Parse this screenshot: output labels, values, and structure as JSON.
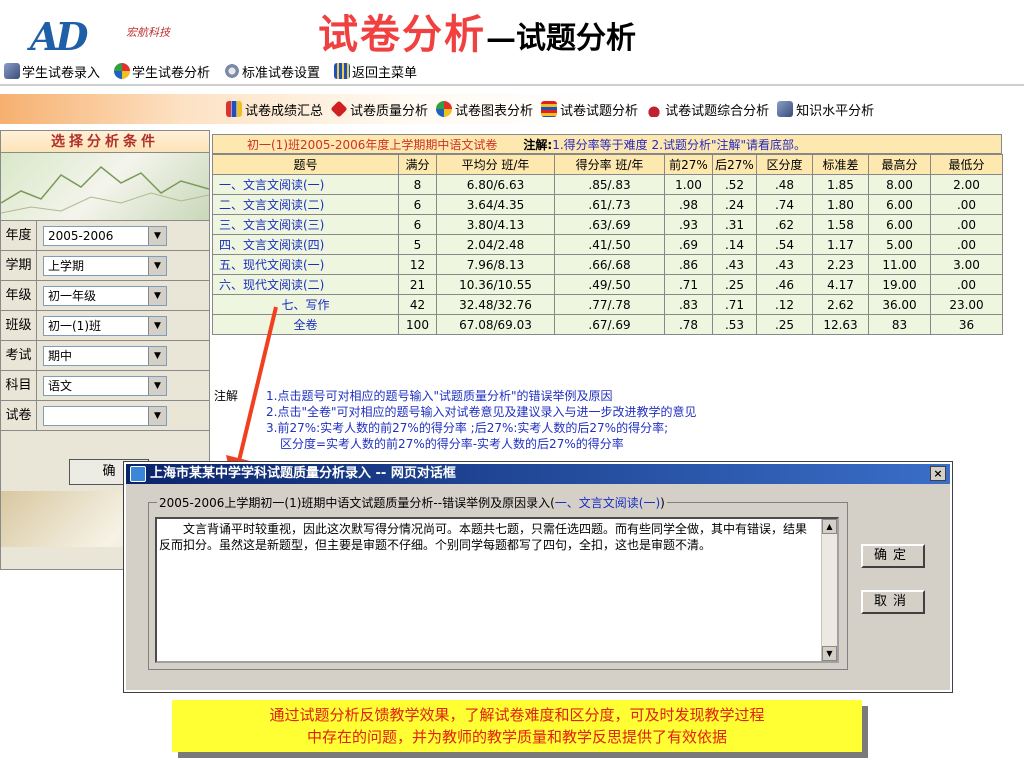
{
  "header": {
    "logo_brand": "宏航科技",
    "title_main": "试卷分析",
    "title_sub": "—试题分析",
    "menu": [
      {
        "label": "学生试卷录入",
        "icon": "pencil-icon"
      },
      {
        "label": "学生试卷分析",
        "icon": "pie-chart-icon"
      },
      {
        "label": "标准试卷设置",
        "icon": "settings-icon"
      },
      {
        "label": "返回主菜单",
        "icon": "grid-icon"
      }
    ]
  },
  "tabs": [
    {
      "label": "试卷成绩汇总",
      "icon": "bar-chart-icon"
    },
    {
      "label": "试卷质量分析",
      "icon": "diamond-icon"
    },
    {
      "label": "试卷图表分析",
      "icon": "pie-chart-icon"
    },
    {
      "label": "试卷试题分析",
      "icon": "table-icon"
    },
    {
      "label": "试卷试题综合分析",
      "icon": "cap-icon"
    },
    {
      "label": "知识水平分析",
      "icon": "pencil-icon"
    }
  ],
  "left_panel": {
    "title": "选择分析条件",
    "filters": [
      {
        "label": "年度",
        "value": "2005-2006"
      },
      {
        "label": "学期",
        "value": "上学期"
      },
      {
        "label": "年级",
        "value": "初一年级"
      },
      {
        "label": "班级",
        "value": "初一(1)班"
      },
      {
        "label": "考试",
        "value": "期中"
      },
      {
        "label": "科目",
        "value": "语文"
      },
      {
        "label": "试卷",
        "value": ""
      }
    ],
    "confirm_label": "确"
  },
  "table": {
    "title": "初一(1)班2005-2006年度上学期期中语文试卷",
    "note_label": "注解:",
    "note_text": "1.得分率等于难度 2.试题分析\"注解\"请看底部。",
    "headers": [
      "题号",
      "满分",
      "平均分 班/年",
      "得分率 班/年",
      "前27%",
      "后27%",
      "区分度",
      "标准差",
      "最高分",
      "最低分"
    ],
    "rows": [
      [
        "一、文言文阅读(一)",
        "8",
        "6.80/6.63",
        ".85/.83",
        "1.00",
        ".52",
        ".48",
        "1.85",
        "8.00",
        "2.00"
      ],
      [
        "二、文言文阅读(二)",
        "6",
        "3.64/4.35",
        ".61/.73",
        ".98",
        ".24",
        ".74",
        "1.80",
        "6.00",
        ".00"
      ],
      [
        "三、文言文阅读(三)",
        "6",
        "3.80/4.13",
        ".63/.69",
        ".93",
        ".31",
        ".62",
        "1.58",
        "6.00",
        ".00"
      ],
      [
        "四、文言文阅读(四)",
        "5",
        "2.04/2.48",
        ".41/.50",
        ".69",
        ".14",
        ".54",
        "1.17",
        "5.00",
        ".00"
      ],
      [
        "五、现代文阅读(一)",
        "12",
        "7.96/8.13",
        ".66/.68",
        ".86",
        ".43",
        ".43",
        "2.23",
        "11.00",
        "3.00"
      ],
      [
        "六、现代文阅读(二)",
        "21",
        "10.36/10.55",
        ".49/.50",
        ".71",
        ".25",
        ".46",
        "4.17",
        "19.00",
        ".00"
      ],
      [
        "七、写作",
        "42",
        "32.48/32.76",
        ".77/.78",
        ".83",
        ".71",
        ".12",
        "2.62",
        "36.00",
        "23.00"
      ],
      [
        "全卷",
        "100",
        "67.08/69.03",
        ".67/.69",
        ".78",
        ".53",
        ".25",
        "12.63",
        "83",
        "36"
      ]
    ]
  },
  "notes": {
    "label": "注解",
    "lines": [
      "1.点击题号可对相应的题号输入\"试题质量分析\"的错误举例及原因",
      "2.点击\"全卷\"可对相应的题号输入对试卷意见及建议录入与进一步改进教学的意见",
      "3.前27%:实考人数的前27%的得分率 ;后27%:实考人数的后27%的得分率;",
      "区分度=实考人数的前27%的得分率-实考人数的后27%的得分率"
    ]
  },
  "dialog": {
    "title": "上海市某某中学学科试题质量分析录入 -- 网页对话框",
    "close": "×",
    "legend_prefix": "2005-2006上学期初一(1)班期中语文试题质量分析--错误举例及原因录入(",
    "legend_item": "一、文言文阅读(一)",
    "legend_suffix": ")",
    "text": "　　文言背诵平时较重视，因此这次默写得分情况尚可。本题共七题，只需任选四题。而有些同学全做，其中有错误，结果反而扣分。虽然这是新题型，但主要是审题不仔细。个别同学每题都写了四句，全扣，这也是审题不清。",
    "ok_label": "确定",
    "cancel_label": "取消"
  },
  "caption": {
    "line1": "通过试题分析反馈教学效果，了解试卷难度和区分度，可及时发现教学过程",
    "line2": "中存在的问题，并为教师的教学质量和教学反思提供了有效依据"
  },
  "colors": {
    "title_red": "#f04040",
    "table_header_bg": "#fde9b0",
    "table_cell_bg": "#eef6e0",
    "link_blue": "#1a2ec0",
    "caption_bg": "#ffff33",
    "dialog_title_bg": "#0a246a"
  }
}
